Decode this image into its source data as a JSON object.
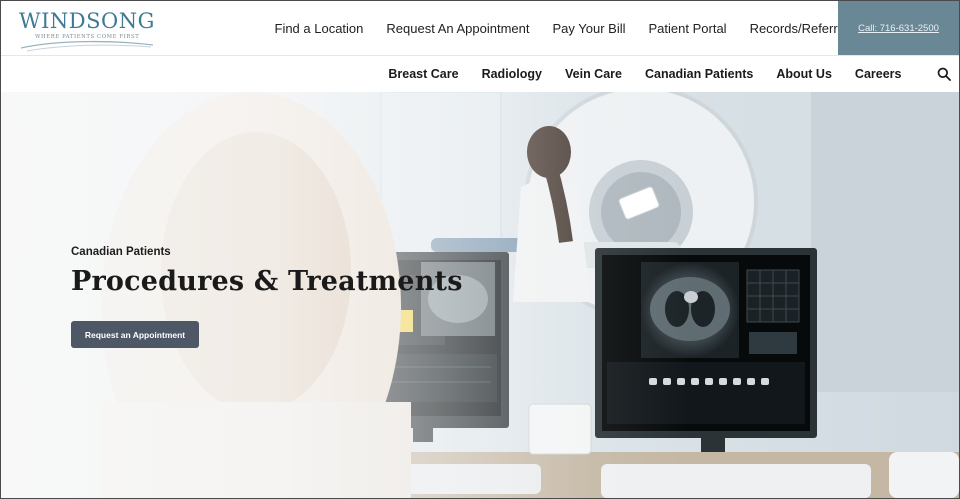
{
  "brand": {
    "name": "WINDSONG",
    "tagline": "WHERE PATIENTS COME FIRST",
    "color": "#3f7a95"
  },
  "utility_nav": [
    {
      "label": "Find a Location"
    },
    {
      "label": "Request An Appointment"
    },
    {
      "label": "Pay Your Bill"
    },
    {
      "label": "Patient Portal"
    },
    {
      "label": "Records/Referrers"
    }
  ],
  "call": {
    "label": "Call: 716-631-2500",
    "bg": "#6a8796"
  },
  "main_nav": [
    {
      "label": "Breast Care"
    },
    {
      "label": "Radiology"
    },
    {
      "label": "Vein Care"
    },
    {
      "label": "Canadian Patients"
    },
    {
      "label": "About Us"
    },
    {
      "label": "Careers"
    }
  ],
  "search": {
    "icon": "search-icon"
  },
  "hero": {
    "eyebrow": "Canadian Patients",
    "title": "Procedures & Treatments",
    "cta_label": "Request an Appointment",
    "cta_color": "#4e5765"
  }
}
